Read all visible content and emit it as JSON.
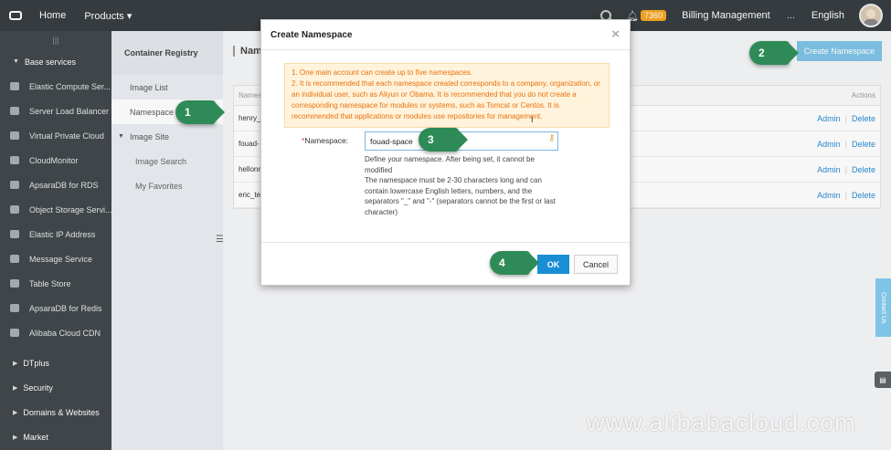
{
  "topbar": {
    "home": "Home",
    "products": "Products",
    "badge": "7360",
    "billing": "Billing Management",
    "more": "...",
    "language": "English"
  },
  "sidebar": {
    "base_services": "Base services",
    "items": [
      {
        "label": "Elastic Compute Ser...",
        "icon": "server-icon"
      },
      {
        "label": "Server Load Balancer",
        "icon": "network-icon"
      },
      {
        "label": "Virtual Private Cloud",
        "icon": "cloud-icon"
      },
      {
        "label": "CloudMonitor",
        "icon": "eye-icon"
      },
      {
        "label": "ApsaraDB for RDS",
        "icon": "database-icon"
      },
      {
        "label": "Object Storage Servi...",
        "icon": "storage-icon"
      },
      {
        "label": "Elastic IP Address",
        "icon": "ip-icon"
      },
      {
        "label": "Message Service",
        "icon": "message-icon"
      },
      {
        "label": "Table Store",
        "icon": "table-icon"
      },
      {
        "label": "ApsaraDB for Redis",
        "icon": "redis-icon"
      },
      {
        "label": "Alibaba Cloud CDN",
        "icon": "cdn-icon"
      }
    ],
    "groups": [
      "DTplus",
      "Security",
      "Domains & Websites",
      "Market"
    ]
  },
  "subnav": {
    "title": "Container Registry",
    "image_list": "Image List",
    "namespace": "Namespace",
    "image_site": "Image Site",
    "image_search": "Image Search",
    "my_favorites": "My Favorites"
  },
  "main": {
    "title": "Name",
    "create_button": "Create Namespace",
    "table_header_name": "Namesp",
    "table_header_actions": "Actions",
    "rows": [
      {
        "name": "henry_",
        "admin": "Admin",
        "delete": "Delete"
      },
      {
        "name": "fouad-",
        "admin": "Admin",
        "delete": "Delete"
      },
      {
        "name": "hellonr",
        "admin": "Admin",
        "delete": "Delete"
      },
      {
        "name": "eric_te",
        "admin": "Admin",
        "delete": "Delete"
      }
    ]
  },
  "modal": {
    "title": "Create Namespace",
    "notice_1": "1. One main account can create up to five namespaces.",
    "notice_2": "2. It is recommended that each namespace created corresponds to a company, organization, or an individual user, such as Aliyun or Obama. It is recommended that you do not create a corresponding namespace for modules or systems, such as Tomcat or Centos. It is recommended that applications or modules use repositories for management.",
    "field_required_mark": "*",
    "field_label": "Namespace:",
    "field_value": "fouad-space",
    "help_1": "Define your namespace. After being set, it cannot be modified",
    "help_2": "The namespace must be 2-30 characters long and can contain lowercase English letters, numbers, and the separators \"_\" and \"-\" (separators cannot be the first or last character)",
    "ok": "OK",
    "cancel": "Cancel"
  },
  "steps": [
    "1",
    "2",
    "3",
    "4"
  ],
  "contact": "Contact Us",
  "watermark": "www.alibabacloud.com",
  "colors": {
    "topbar": "#373d41",
    "sidebar": "#42484b",
    "primary": "#1a8dd3",
    "step": "#2e8b57",
    "notice_text": "#e8720c"
  }
}
